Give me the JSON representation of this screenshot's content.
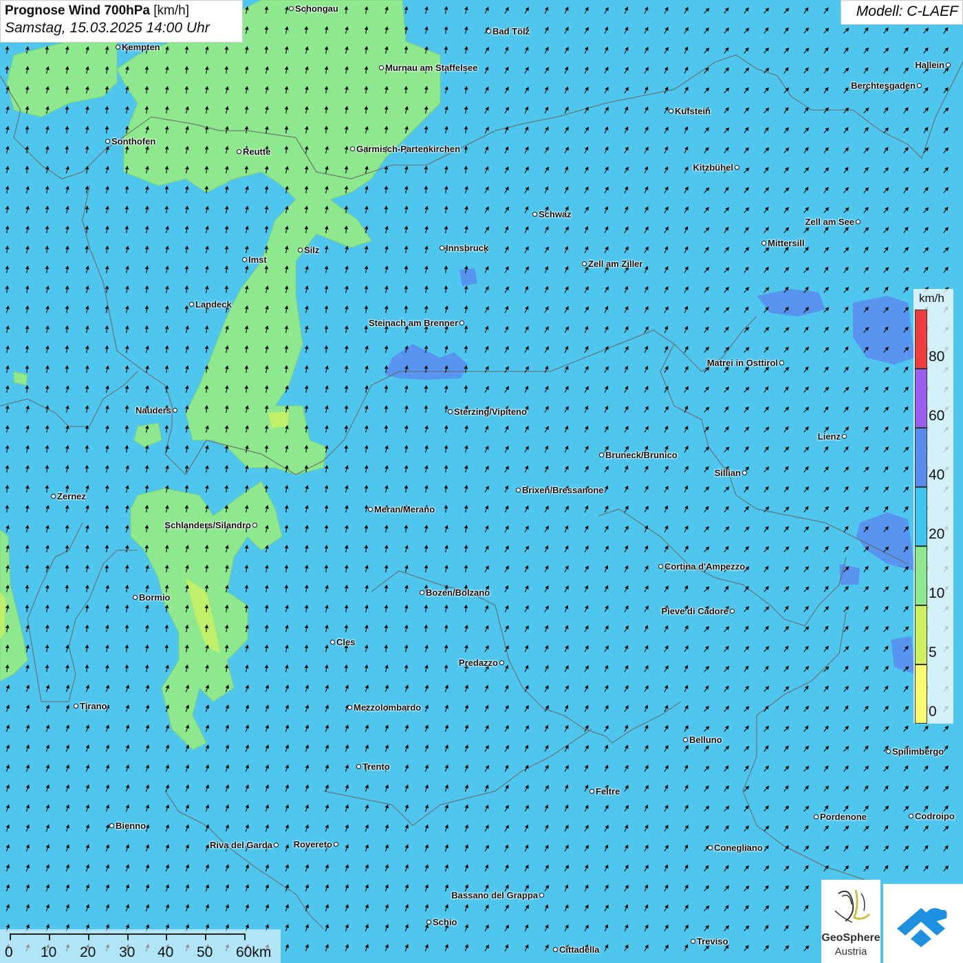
{
  "header": {
    "title_bold": "Prognose Wind 700hPa",
    "title_unit": "[km/h]",
    "datetime": "Samstag, 15.03.2025 14:00 Uhr",
    "model": "Modell: C-LAEF"
  },
  "legend": {
    "unit": "km/h",
    "levels": [
      {
        "label": "0",
        "color": "#fafa6e"
      },
      {
        "label": "5",
        "color": "#cdf060"
      },
      {
        "label": "10",
        "color": "#8ee88e"
      },
      {
        "label": "20",
        "color": "#3cc6f0"
      },
      {
        "label": "40",
        "color": "#5a8cf0"
      },
      {
        "label": "60",
        "color": "#9a5ef0"
      },
      {
        "label": "80",
        "color": "#f03c3c"
      }
    ]
  },
  "scalebar": {
    "labels": [
      "0",
      "10",
      "20",
      "30",
      "40",
      "50",
      "60km"
    ]
  },
  "logos": {
    "geosphere_line1": "GeoSphere",
    "geosphere_line2": "Austria"
  },
  "cities": [
    {
      "name": "Schongau",
      "side": "right"
    },
    {
      "name": "Bad Tölz",
      "side": "right"
    },
    {
      "name": "Kempten",
      "side": "right"
    },
    {
      "name": "Murnau am Staffelsee",
      "side": "right"
    },
    {
      "name": "Hallein",
      "side": "left"
    },
    {
      "name": "Berchtesgaden",
      "side": "left"
    },
    {
      "name": "Kufstein",
      "side": "right"
    },
    {
      "name": "Sonthofen",
      "side": "right"
    },
    {
      "name": "Reutte",
      "side": "right"
    },
    {
      "name": "Garmisch-Partenkirchen",
      "side": "right"
    },
    {
      "name": "Kitzbühel",
      "side": "left"
    },
    {
      "name": "Schwaz",
      "side": "right"
    },
    {
      "name": "Zell am See",
      "side": "left"
    },
    {
      "name": "Mittersill",
      "side": "right"
    },
    {
      "name": "Innsbruck",
      "side": "right"
    },
    {
      "name": "Silz",
      "side": "right"
    },
    {
      "name": "Imst",
      "side": "right"
    },
    {
      "name": "Zell am Ziller",
      "side": "right"
    },
    {
      "name": "Landeck",
      "side": "right"
    },
    {
      "name": "Steinach am Brenner",
      "side": "left"
    },
    {
      "name": "Matrei in Osttirol",
      "side": "left"
    },
    {
      "name": "Nauders",
      "side": "left"
    },
    {
      "name": "Sterzing/Vipiteno",
      "side": "right"
    },
    {
      "name": "Lienz",
      "side": "left"
    },
    {
      "name": "Bruneck/Brunico",
      "side": "right"
    },
    {
      "name": "Sillian",
      "side": "left"
    },
    {
      "name": "Zernez",
      "side": "right"
    },
    {
      "name": "Brixen/Bressanone",
      "side": "right"
    },
    {
      "name": "Meran/Merano",
      "side": "right"
    },
    {
      "name": "Schlanders/Silandro",
      "side": "left"
    },
    {
      "name": "Cortina d'Ampezzo",
      "side": "right"
    },
    {
      "name": "Bozen/Bolzano",
      "side": "right"
    },
    {
      "name": "Bormio",
      "side": "right"
    },
    {
      "name": "Pieve di Cadore",
      "side": "left"
    },
    {
      "name": "Cles",
      "side": "right"
    },
    {
      "name": "Predazzo",
      "side": "left"
    },
    {
      "name": "Tirano",
      "side": "right"
    },
    {
      "name": "Mezzolombardo",
      "side": "right"
    },
    {
      "name": "Belluno",
      "side": "right"
    },
    {
      "name": "Spilimbergo",
      "side": "right"
    },
    {
      "name": "Trento",
      "side": "right"
    },
    {
      "name": "Feltre",
      "side": "right"
    },
    {
      "name": "Pordenone",
      "side": "right"
    },
    {
      "name": "Codroipo",
      "side": "right"
    },
    {
      "name": "Bienno",
      "side": "right"
    },
    {
      "name": "Riva del Garda",
      "side": "left"
    },
    {
      "name": "Rovereto",
      "side": "left"
    },
    {
      "name": "Conegliano",
      "side": "right"
    },
    {
      "name": "Bassano del Grappa",
      "side": "left"
    },
    {
      "name": "Schio",
      "side": "right"
    },
    {
      "name": "Treviso",
      "side": "right"
    },
    {
      "name": "Cittadella",
      "side": "right"
    }
  ]
}
